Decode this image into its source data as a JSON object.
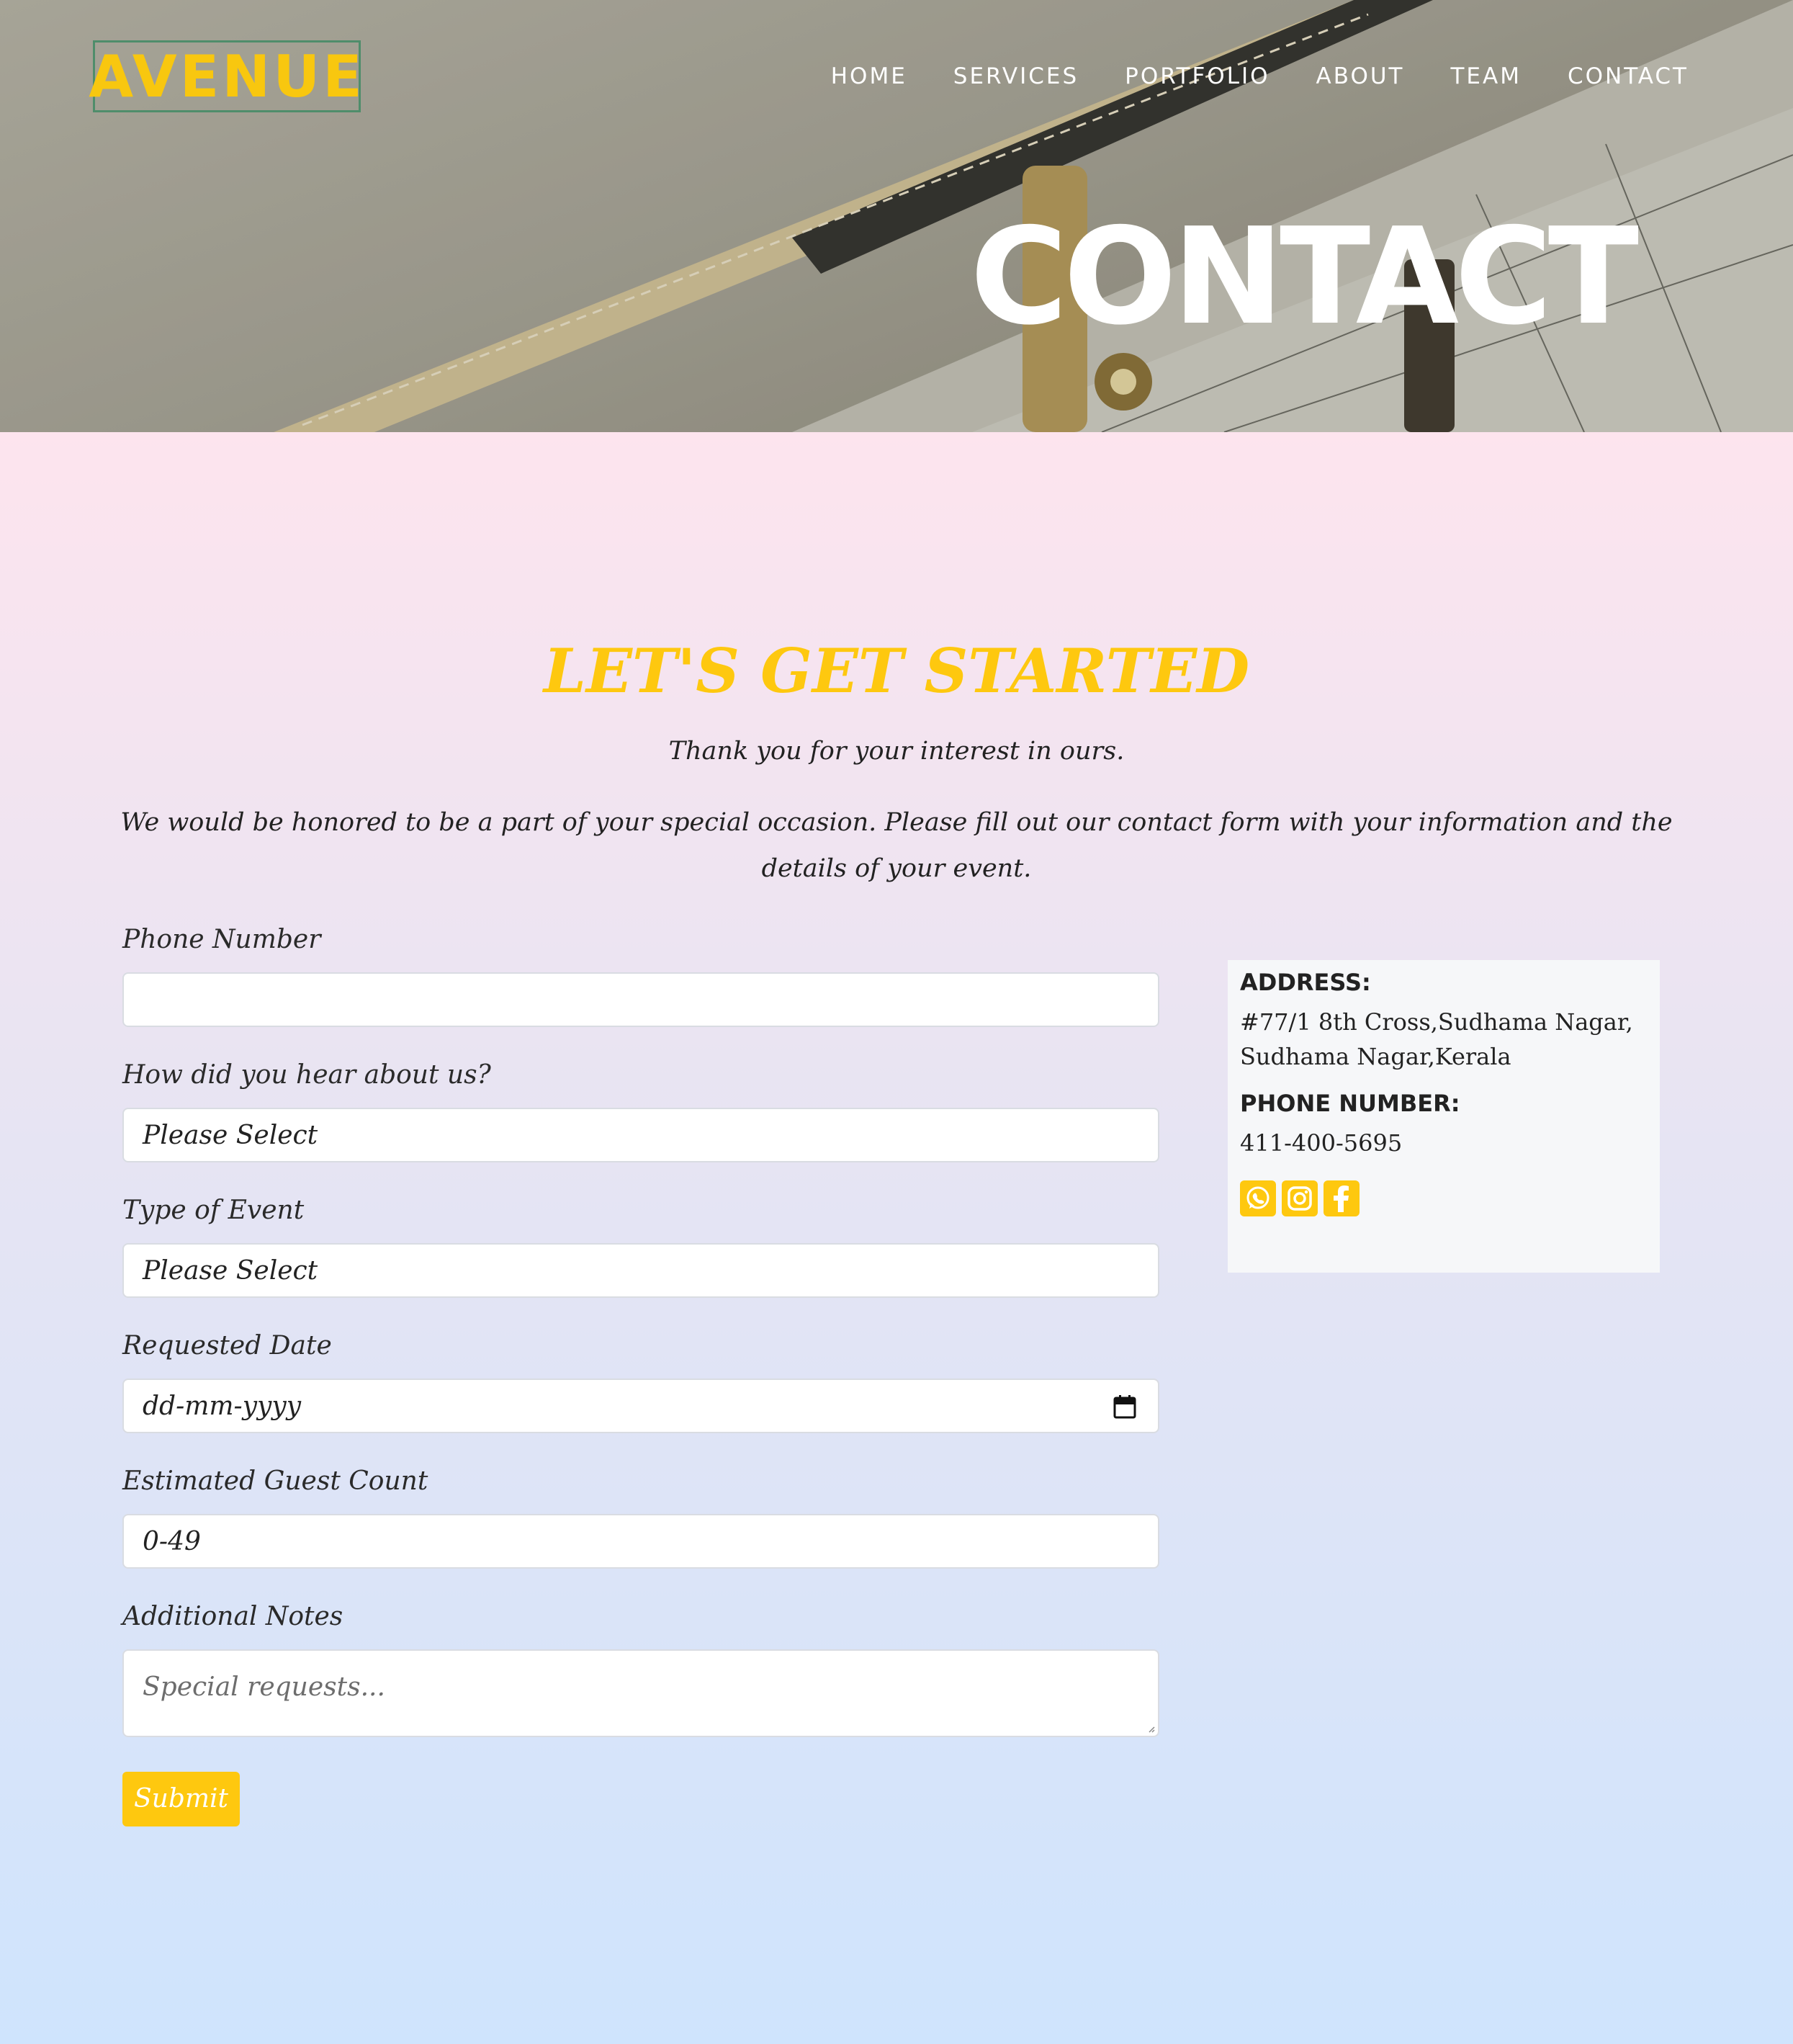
{
  "brand": {
    "logo": "AVENUE",
    "accent_color": "#fec80f"
  },
  "nav": {
    "items": [
      "HOME",
      "SERVICES",
      "PORTFOLIO",
      "ABOUT",
      "TEAM",
      "CONTACT"
    ]
  },
  "hero": {
    "title": "CONTACT",
    "image": "planner-calendar-photo"
  },
  "intro": {
    "heading": "LET'S GET STARTED",
    "subheading": "Thank you for your interest in ours.",
    "text": "We would be honored to be a part of your special occasion. Please fill out our contact form with your information and the details of your event."
  },
  "form": {
    "phone": {
      "label": "Phone Number",
      "value": ""
    },
    "source": {
      "label": "How did you hear about us?",
      "value": "Please Select"
    },
    "event_type": {
      "label": "Type of Event",
      "value": "Please Select"
    },
    "date": {
      "label": "Requested Date",
      "value": "dd-mm-yyyy"
    },
    "guests": {
      "label": "Estimated Guest Count",
      "value": "0-49"
    },
    "notes": {
      "label": "Additional Notes",
      "placeholder": "Special requests..."
    },
    "submit_label": "Submit"
  },
  "contact": {
    "address_label": "ADDRESS:",
    "address_line1": "#77/1 8th Cross,Sudhama Nagar,",
    "address_line2": "Sudhama Nagar,Kerala",
    "phone_label": "PHONE NUMBER:",
    "phone": "411-400-5695",
    "social": [
      "whatsapp-icon",
      "instagram-icon",
      "facebook-icon"
    ]
  }
}
